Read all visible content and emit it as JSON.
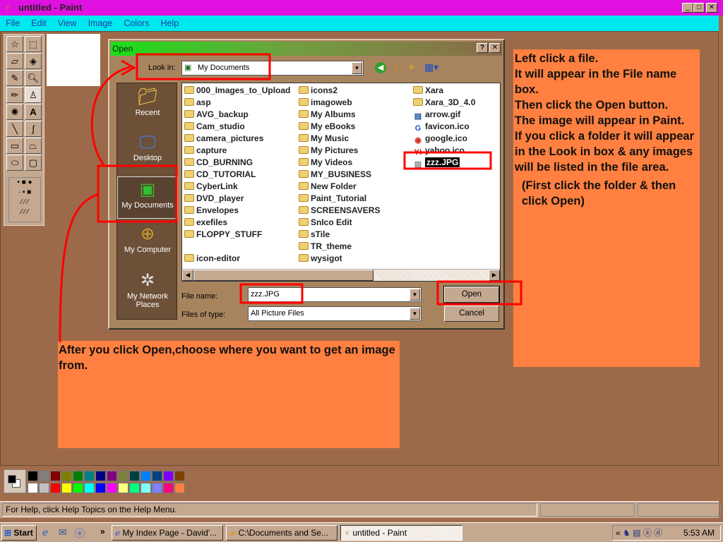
{
  "window": {
    "title": "untitled - Paint",
    "minimize": "_",
    "maximize": "□",
    "close": "✕"
  },
  "menu": [
    "File",
    "Edit",
    "View",
    "Image",
    "Colors",
    "Help"
  ],
  "dialog": {
    "title": "Open",
    "help": "?",
    "close": "✕",
    "look_in_label": "Look in:",
    "look_in_value": "My Documents",
    "places": [
      "Recent",
      "Desktop",
      "My Documents",
      "My Computer",
      "My Network Places"
    ],
    "files": [
      [
        "000_Images_to_Upload",
        "asp",
        "AVG_backup",
        "Cam_studio",
        "camera_pictures",
        "capture",
        "CD_BURNING",
        "CD_TUTORIAL",
        "CyberLink",
        "DVD_player",
        "Envelopes",
        "exefiles",
        "FLOPPY_STUFF",
        "",
        "icon-editor"
      ],
      [
        "icons2",
        "imagoweb",
        "My Albums",
        "My eBooks",
        "My Music",
        "My Pictures",
        "My Videos",
        "MY_BUSINESS",
        "New Folder",
        "Paint_Tutorial",
        "SCREENSAVERS",
        "SnIco Edit",
        "sTile",
        "TR_theme",
        "wysigot"
      ],
      [
        "Xara",
        "Xara_3D_4.0",
        "arrow.gif",
        "favicon.ico",
        "google.ico",
        "yahoo.ico",
        "zzz.JPG"
      ]
    ],
    "selected_file": "zzz.JPG",
    "file_name_label": "File name:",
    "file_name_value": "zzz.JPG",
    "files_of_type_label": "Files of type:",
    "files_of_type_value": "All Picture Files",
    "open_button": "Open",
    "cancel_button": "Cancel"
  },
  "annotations": {
    "right": [
      "Left click a file.",
      "It will appear in the File name box.",
      "Then click the Open button.",
      "The image will appear in Paint.",
      "If you click a folder it will appear in the Look in box & any images will be listed in the file area."
    ],
    "right_note": "(First click the folder & then click Open)",
    "bottom": "After you click Open,choose where you want to get an image from."
  },
  "palette": {
    "top": [
      "#000000",
      "#808080",
      "#800000",
      "#808000",
      "#008000",
      "#008080",
      "#000080",
      "#800080",
      "#808040",
      "#004040",
      "#0080ff",
      "#004080",
      "#8000ff",
      "#804000"
    ],
    "bottom": [
      "#ffffff",
      "#c0c0c0",
      "#ff0000",
      "#ffff00",
      "#00ff00",
      "#00ffff",
      "#0000ff",
      "#ff00ff",
      "#ffff80",
      "#00ff80",
      "#80ffff",
      "#8080ff",
      "#ff0080",
      "#ff8040"
    ]
  },
  "status": {
    "help": "For Help, click Help Topics on the Help Menu."
  },
  "taskbar": {
    "start": "Start",
    "chevron": "»",
    "tasks": [
      "My Index Page - David'...",
      "C:\\Documents and Se...",
      "untitled - Paint"
    ],
    "tray_chevron": "«",
    "clock": "5:53 AM"
  }
}
